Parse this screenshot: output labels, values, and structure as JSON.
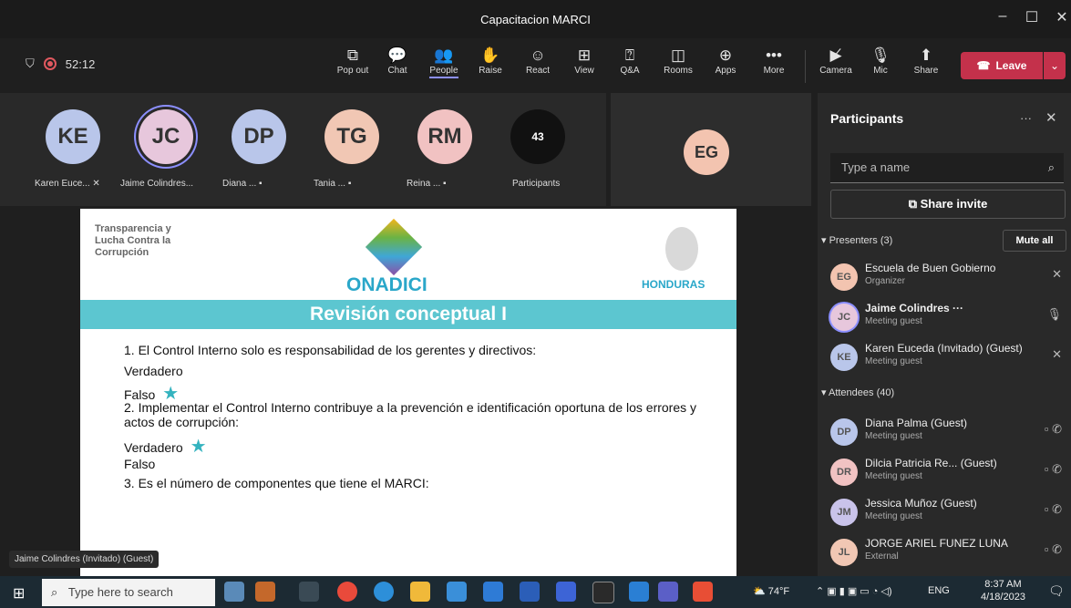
{
  "window": {
    "title": "Capacitacion MARCI"
  },
  "toolbar": {
    "timer": "52:12",
    "buttons": [
      {
        "label": "Pop out",
        "icon": "pop-out-icon"
      },
      {
        "label": "Chat",
        "icon": "chat-icon"
      },
      {
        "label": "People",
        "icon": "people-icon"
      },
      {
        "label": "Raise",
        "icon": "raise-hand-icon"
      },
      {
        "label": "React",
        "icon": "react-icon"
      },
      {
        "label": "View",
        "icon": "view-icon"
      },
      {
        "label": "Q&A",
        "icon": "qa-icon"
      },
      {
        "label": "Rooms",
        "icon": "rooms-icon"
      },
      {
        "label": "Apps",
        "icon": "apps-icon"
      },
      {
        "label": "More",
        "icon": "more-icon"
      },
      {
        "label": "Camera",
        "icon": "camera-off-icon"
      },
      {
        "label": "Mic",
        "icon": "mic-off-icon"
      },
      {
        "label": "Share",
        "icon": "share-icon"
      }
    ],
    "leave_label": "Leave"
  },
  "stage": {
    "avatars": [
      {
        "initials": "KE",
        "name": "Karen Euce...",
        "color": "#b9c6ea"
      },
      {
        "initials": "JC",
        "name": "Jaime Colindres...",
        "color": "#e7c7dc"
      },
      {
        "initials": "DP",
        "name": "Diana ...",
        "color": "#b9c6ea"
      },
      {
        "initials": "TG",
        "name": "Tania ...",
        "color": "#f1c7b4"
      },
      {
        "initials": "RM",
        "name": "Reina ...",
        "color": "#f1c2c2"
      }
    ],
    "participants_count": "43",
    "participants_label": "Participants",
    "tile_initials": "EG",
    "speaker_label": "Jaime Colindres (Invitado) (Guest)"
  },
  "slide": {
    "logo_left_lines": [
      "Transparencia y",
      "Lucha Contra la",
      "Corrupción"
    ],
    "logo_center": "ONADICI",
    "logo_right": "HONDURAS",
    "title": "Revisión conceptual I",
    "lines": [
      "1.   El Control Interno solo es responsabilidad de los gerentes y directivos:",
      "Verdadero",
      "Falso",
      "2. Implementar el Control Interno contribuye a la prevención e identificación oportuna de los errores y actos de corrupción:",
      "Verdadero",
      "Falso",
      "3.   Es el número de componentes que tiene el MARCI:"
    ]
  },
  "panel": {
    "title": "Participants",
    "search_placeholder": "Type a name",
    "share_invite": "Share invite",
    "presenters_label": "Presenters (3)",
    "mute_all": "Mute all",
    "presenters": [
      {
        "initials": "EG",
        "name": "Escuela de Buen Gobierno",
        "role": "Organizer",
        "color": "#f3c4b0"
      },
      {
        "initials": "JC",
        "name": "Jaime Colindres ···",
        "role": "Meeting guest",
        "color": "#e7c7dc"
      },
      {
        "initials": "KE",
        "name": "Karen Euceda (Invitado) (Guest)",
        "role": "Meeting guest",
        "color": "#b9c6ea"
      }
    ],
    "attendees_label": "Attendees (40)",
    "attendees": [
      {
        "initials": "DP",
        "name": "Diana Palma (Guest)",
        "role": "Meeting guest",
        "color": "#b9c6ea"
      },
      {
        "initials": "DR",
        "name": "Dilcia Patricia Re...  (Guest)",
        "role": "Meeting guest",
        "color": "#f1c2c2"
      },
      {
        "initials": "JM",
        "name": "Jessica Muñoz (Guest)",
        "role": "Meeting guest",
        "color": "#c9c3ea"
      },
      {
        "initials": "JL",
        "name": "JORGE ARIEL FUNEZ LUNA",
        "role": "External",
        "color": "#f1c7b4"
      }
    ]
  },
  "taskbar": {
    "search_placeholder": "Type here to search",
    "weather": "74°F",
    "lang": "ENG",
    "time": "8:37 AM",
    "date": "4/18/2023"
  }
}
